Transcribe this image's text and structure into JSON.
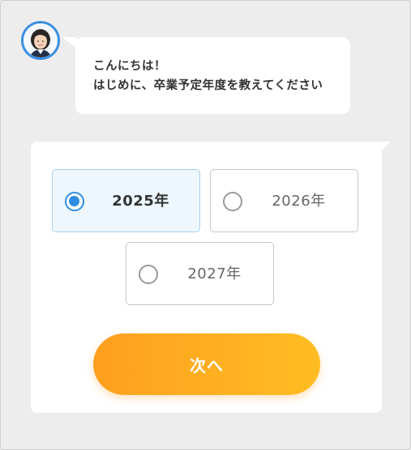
{
  "greeting": {
    "line1": "こんにちは！",
    "line2": "はじめに、卒業予定年度を教えてください"
  },
  "options": [
    {
      "label": "2025年",
      "selected": true
    },
    {
      "label": "2026年",
      "selected": false
    },
    {
      "label": "2027年",
      "selected": false
    }
  ],
  "next_button": {
    "label": "次へ"
  },
  "colors": {
    "accent_blue": "#2f8ee0",
    "button_gradient_start": "#ff9f1f",
    "button_gradient_end": "#ffbd22",
    "selected_bg": "#eef7fd"
  }
}
